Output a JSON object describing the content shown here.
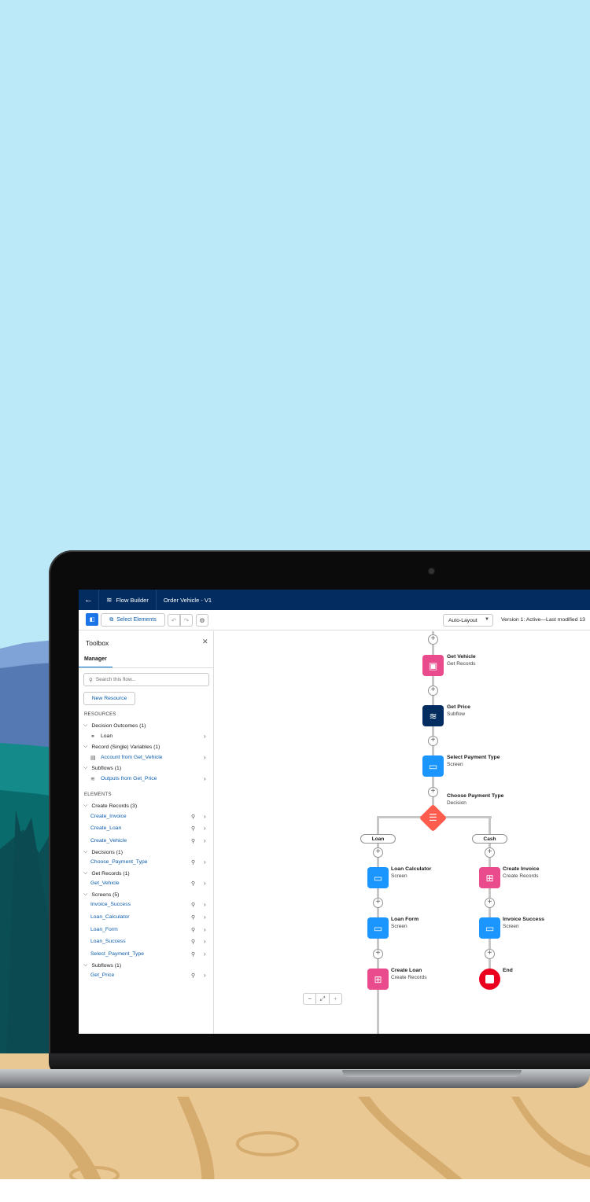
{
  "header": {
    "app_name": "Flow Builder",
    "flow_name": "Order Vehicle - V1",
    "back_icon": "arrow-left-icon",
    "app_icon": "flow-icon"
  },
  "toolbar": {
    "select_elements": "Select Elements",
    "layout_mode": "Auto-Layout",
    "version_status": "Version 1: Active—Last modified 13"
  },
  "sidebar": {
    "title": "Toolbox",
    "tab": "Manager",
    "search_placeholder": "Search this flow...",
    "new_resource": "New Resource",
    "resources_heading": "RESOURCES",
    "elements_heading": "ELEMENTS",
    "resources": {
      "decision_outcomes": "Decision Outcomes (1)",
      "loan": "Loan",
      "record_vars": "Record (Single) Variables (1)",
      "account_var": "Account from Get_Vehicle",
      "subflows": "Subflows (1)",
      "outputs": "Outputs from Get_Price"
    },
    "elements": {
      "create_records": "Create Records (3)",
      "create_invoice": "Create_Invoice",
      "create_loan": "Create_Loan",
      "create_vehicle": "Create_Vehicle",
      "decisions": "Decisions (1)",
      "choose_payment": "Choose_Payment_Type",
      "get_records": "Get Records (1)",
      "get_vehicle": "Get_Vehicle",
      "screens": "Screens (5)",
      "invoice_success": "Invoice_Success",
      "loan_calculator": "Loan_Calculator",
      "loan_form": "Loan_Form",
      "loan_success": "Loan_Success",
      "select_payment": "Select_Payment_Type",
      "subflows": "Subflows (1)",
      "get_price": "Get_Price"
    }
  },
  "canvas": {
    "get_vehicle": {
      "title": "Get Vehicle",
      "sub": "Get Records"
    },
    "get_price": {
      "title": "Get Price",
      "sub": "Subflow"
    },
    "select_payment": {
      "title": "Select Payment Type",
      "sub": "Screen"
    },
    "choose_payment": {
      "title": "Choose Payment Type",
      "sub": "Decision"
    },
    "branch_loan": "Loan",
    "branch_cash": "Cash",
    "loan_calculator": {
      "title": "Loan Calculator",
      "sub": "Screen"
    },
    "loan_form": {
      "title": "Loan Form",
      "sub": "Screen"
    },
    "create_loan": {
      "title": "Create Loan",
      "sub": "Create Records"
    },
    "create_invoice": {
      "title": "Create Invoice",
      "sub": "Create Records"
    },
    "invoice_success": {
      "title": "Invoice Success",
      "sub": "Screen"
    },
    "end": "End"
  },
  "colors": {
    "header": "#032d60",
    "accent": "#0176d3",
    "record": "#ea4b8c",
    "screen": "#1b96ff",
    "decision": "#fe5c4c",
    "end": "#ea001e",
    "sky": "#bbe9f8"
  }
}
